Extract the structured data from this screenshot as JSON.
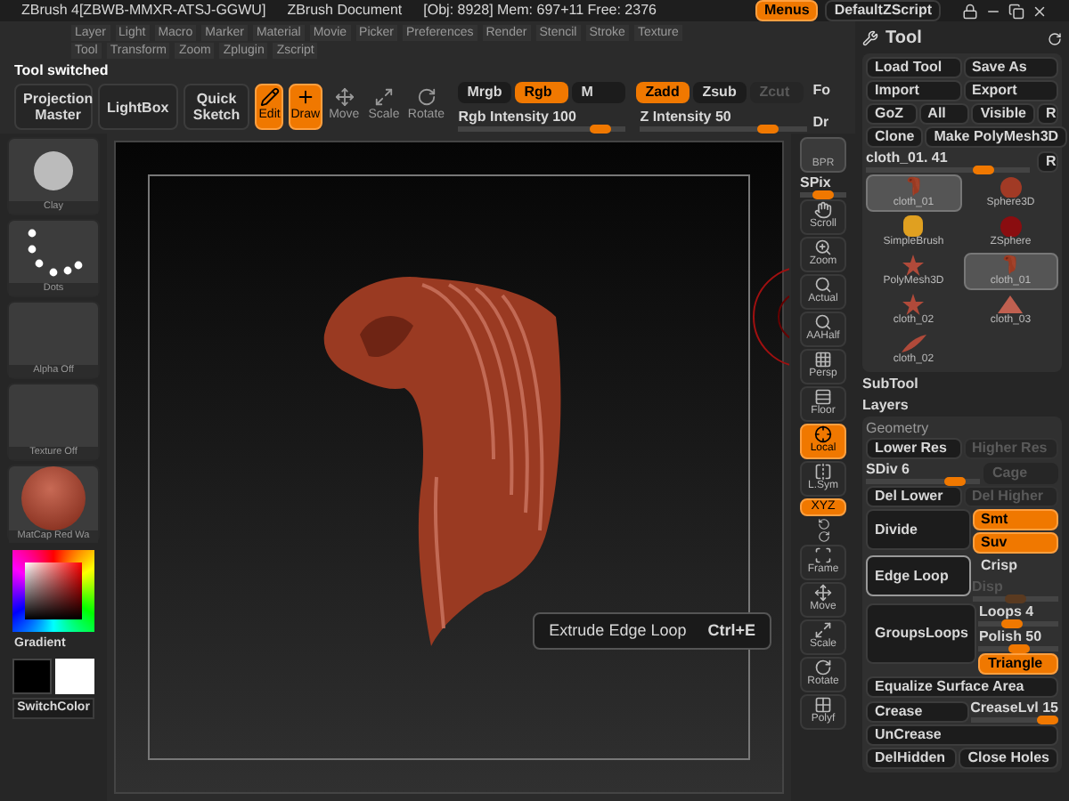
{
  "title_bar": {
    "app": "ZBrush 4[ZBWB-MMXR-ATSJ-GGWU]",
    "document": "ZBrush Document",
    "stats": "[Obj: 8928] Mem: 697+11 Free: 2376",
    "buttons": [
      {
        "label": "Menus",
        "selected": true
      },
      {
        "label": "DefaultZScript",
        "selected": false
      }
    ]
  },
  "menu_bar": {
    "items": [
      "Layer",
      "Light",
      "Macro",
      "Marker",
      "Material",
      "Movie",
      "Picker",
      "Preferences",
      "Render",
      "Stencil",
      "Stroke",
      "Texture",
      "Tool",
      "Transform",
      "Zoom",
      "Zplugin",
      "Zscript"
    ]
  },
  "status": "Tool switched",
  "toolbar": {
    "buttons": [
      {
        "label": "Projection Master",
        "kind": "text",
        "selected": false
      },
      {
        "label": "LightBox",
        "kind": "text",
        "selected": false
      },
      {
        "label": "Quick Sketch",
        "kind": "sketch",
        "selected": false
      },
      {
        "label": "Edit",
        "kind": "mode",
        "selected": true
      },
      {
        "label": "Draw",
        "kind": "mode",
        "selected": true
      },
      {
        "label": "Move",
        "kind": "mode",
        "selected": false
      },
      {
        "label": "Scale",
        "kind": "mode",
        "selected": false
      },
      {
        "label": "Rotate",
        "kind": "mode",
        "selected": false
      }
    ],
    "color_modes": [
      {
        "label": "Mrgb",
        "on": false
      },
      {
        "label": "Rgb",
        "on": true
      },
      {
        "label": "M",
        "on": false
      }
    ],
    "depth_modes": [
      {
        "label": "Zadd",
        "on": true,
        "disabled": false
      },
      {
        "label": "Zsub",
        "on": false,
        "disabled": false
      },
      {
        "label": "Zcut",
        "on": false,
        "disabled": true
      }
    ],
    "sliders": [
      {
        "label": "Rgb Intensity",
        "value": "100",
        "level": 0.9
      },
      {
        "label": "Z Intensity",
        "value": "50",
        "level": 0.8
      }
    ],
    "cut_labels": [
      "Fo",
      "Dr"
    ]
  },
  "left_shelf": {
    "items": [
      {
        "label": "Clay",
        "kind": "brush"
      },
      {
        "label": "Dots",
        "kind": "stroke"
      },
      {
        "label": "Alpha Off",
        "kind": "empty"
      },
      {
        "label": "Texture Off",
        "kind": "empty"
      },
      {
        "label": "MatCap Red Wa",
        "kind": "material"
      }
    ],
    "gradient": "Gradient",
    "switch_color": "SwitchColor"
  },
  "canvas": {
    "tooltip": {
      "text": "Extrude Edge Loop",
      "shortcut": "Ctrl+E"
    }
  },
  "right_shelf": [
    {
      "label": "BPR",
      "kind": "sphere",
      "on": false
    },
    {
      "label": "SPix",
      "kind": "slider",
      "level": 0.5
    },
    {
      "label": "Scroll",
      "kind": "tool",
      "on": false
    },
    {
      "label": "Zoom",
      "kind": "tool",
      "on": false
    },
    {
      "label": "Actual",
      "kind": "tool",
      "on": false
    },
    {
      "label": "AAHalf",
      "kind": "tool",
      "on": false
    },
    {
      "label": "Persp",
      "kind": "tool",
      "on": false
    },
    {
      "label": "Floor",
      "kind": "tool",
      "on": false
    },
    {
      "label": "Local",
      "kind": "tool",
      "on": true
    },
    {
      "label": "L.Sym",
      "kind": "tool",
      "on": false
    },
    {
      "label": "XYZ",
      "kind": "toggle",
      "on": true
    },
    {
      "kind": "rotate_pair"
    },
    {
      "label": "Frame",
      "kind": "tool",
      "on": false
    },
    {
      "label": "Move",
      "kind": "tool",
      "on": false
    },
    {
      "label": "Scale",
      "kind": "tool",
      "on": false
    },
    {
      "label": "Rotate",
      "kind": "tool",
      "on": false
    },
    {
      "label": "Polyf",
      "kind": "tool",
      "on": false
    }
  ],
  "tool_panel": {
    "title": "Tool",
    "button_rows": [
      [
        {
          "label": "Load Tool"
        },
        {
          "label": "Save As"
        }
      ],
      [
        {
          "label": "Import"
        },
        {
          "label": "Export"
        }
      ],
      [
        {
          "label": "GoZ"
        },
        {
          "label": "All"
        },
        {
          "label": "Visible"
        },
        {
          "label": "R"
        }
      ],
      [
        {
          "label": "Clone"
        },
        {
          "label": "Make PolyMesh3D"
        }
      ]
    ],
    "tool_slider": {
      "label": "cloth_01. 41",
      "level": 0.75,
      "reset": "R"
    },
    "tools": [
      {
        "label": "cloth_01",
        "kind": "cloth",
        "selected": true
      },
      {
        "label": "Sphere3D",
        "kind": "sphere",
        "selected": false
      },
      {
        "label": "SimpleBrush",
        "kind": "brush",
        "selected": false
      },
      {
        "label": "ZSphere",
        "kind": "zsphere",
        "selected": false
      },
      {
        "label": "PolyMesh3D",
        "kind": "star",
        "selected": false
      },
      {
        "label": "cloth_01",
        "kind": "cloth",
        "selected": true
      },
      {
        "label": "cloth_02",
        "kind": "star",
        "selected": false
      },
      {
        "label": "cloth_03",
        "kind": "triangle",
        "selected": false
      },
      {
        "label": "cloth_02",
        "kind": "strip",
        "selected": false
      }
    ],
    "sections": [
      {
        "label": "SubTool"
      },
      {
        "label": "Layers"
      }
    ]
  },
  "geometry": {
    "title": "Geometry",
    "lower_res": {
      "label": "Lower Res",
      "disabled": false
    },
    "higher_res": {
      "label": "Higher Res",
      "disabled": true
    },
    "sdiv": {
      "label": "SDiv 6",
      "level": 0.85
    },
    "cage": {
      "label": "Cage",
      "disabled": true
    },
    "del_lower": {
      "label": "Del Lower",
      "disabled": false
    },
    "del_higher": {
      "label": "Del Higher",
      "disabled": true
    },
    "divide": "Divide",
    "smt": {
      "label": "Smt",
      "on": true
    },
    "suv": {
      "label": "Suv",
      "on": true
    },
    "edge_loop": {
      "label": "Edge Loop",
      "selected": true
    },
    "crisp": {
      "label": "Crisp",
      "on": false
    },
    "disp": {
      "label": "Disp",
      "level": 0.5,
      "disabled": true
    },
    "groups_loops": "GroupsLoops",
    "loops": {
      "label": "Loops 4",
      "level": 0.4
    },
    "polish": {
      "label": "Polish 50",
      "level": 0.5
    },
    "triangle": {
      "label": "Triangle",
      "on": true
    },
    "equalize": "Equalize Surface Area",
    "crease": "Crease",
    "crease_lvl": {
      "label": "CreaseLvl 15",
      "level": 1.0
    },
    "uncrease": "UnCrease",
    "del_hidden": "DelHidden",
    "close_holes": "Close Holes"
  }
}
